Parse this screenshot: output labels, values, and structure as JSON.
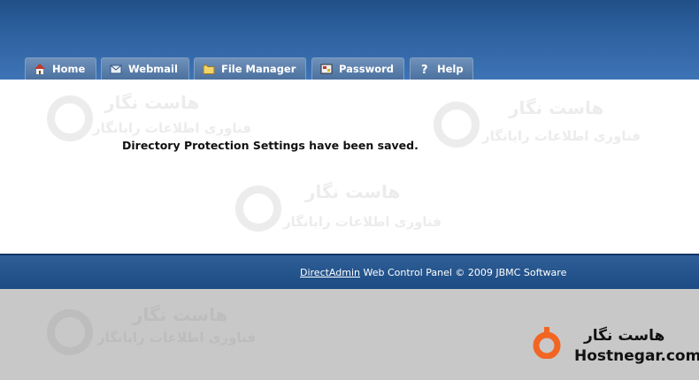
{
  "tabs": [
    {
      "label": "Home",
      "icon": "home-icon"
    },
    {
      "label": "Webmail",
      "icon": "mail-icon"
    },
    {
      "label": "File Manager",
      "icon": "folder-icon"
    },
    {
      "label": "Password",
      "icon": "key-icon"
    },
    {
      "label": "Help",
      "icon": "help-icon"
    }
  ],
  "message": "Directory Protection Settings have been saved.",
  "footer": {
    "link": "DirectAdmin",
    "text": " Web Control Panel © 2009 JBMC Software"
  },
  "watermark": {
    "title": "هاست نگار",
    "subtitle": "فناوری اطلاعات رایانگار"
  },
  "brand": {
    "name_fa": "هاست نگار",
    "name_en": "Hostnegar.com"
  },
  "colors": {
    "header": "#2e62a1",
    "tab": "#5a7fae",
    "footer": "#1f4d86",
    "brand_orange": "#f26522"
  }
}
